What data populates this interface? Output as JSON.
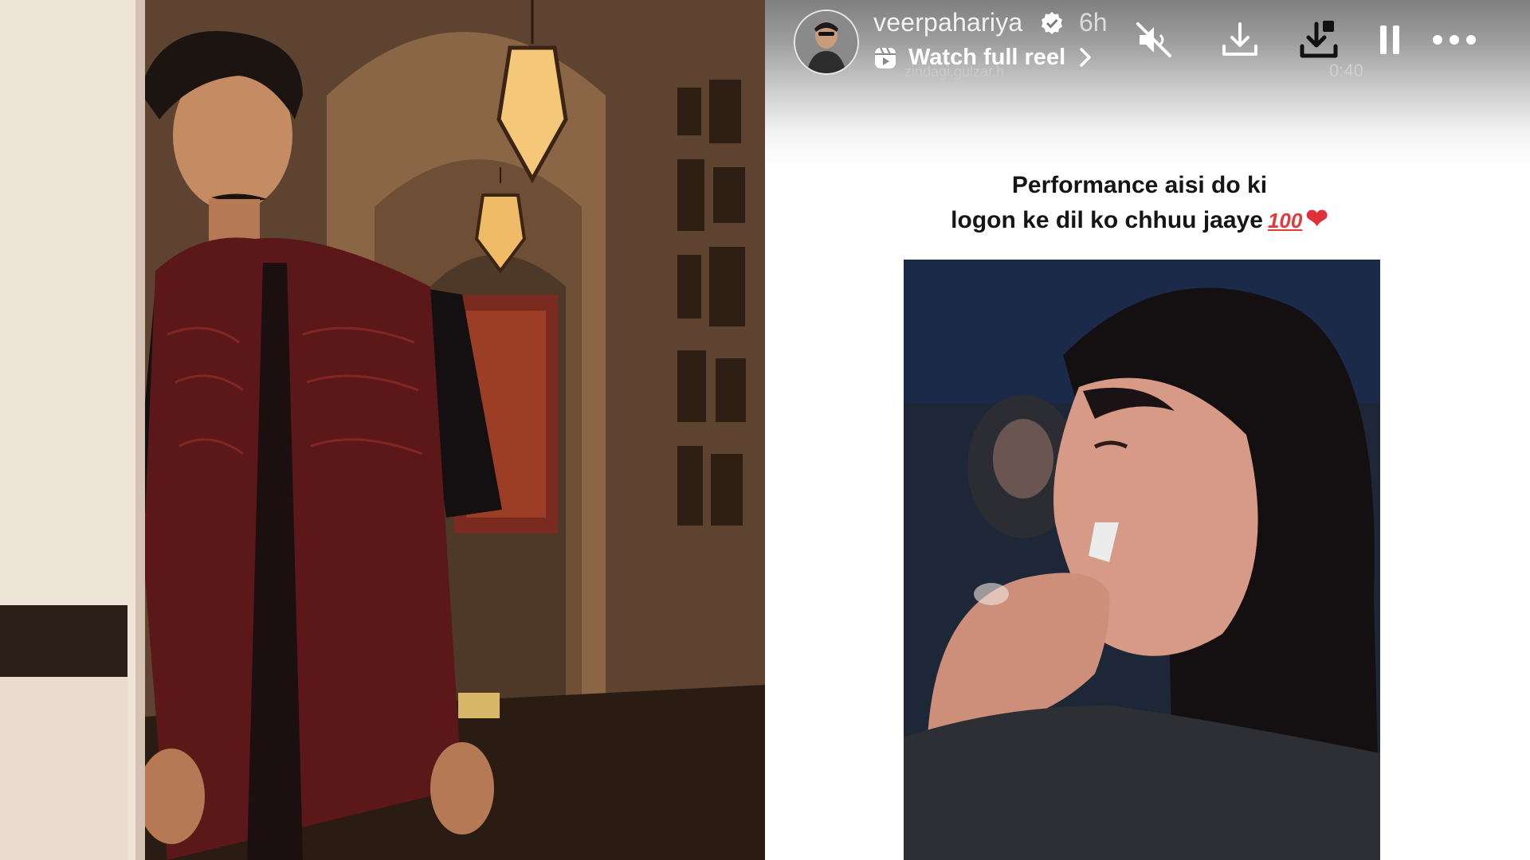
{
  "story": {
    "username": "veerpahariya",
    "timestamp": "6h",
    "reel_link_label": "Watch full reel",
    "faint_overlay_text": "zindagi.gulzar.h",
    "faint_time": "0:40",
    "caption": {
      "line1": "Performance aisi do ki",
      "line2": "logon ke dil ko chhuu jaaye",
      "emoji_100": "100",
      "emoji_heart": "❤"
    },
    "controls": {
      "mute_icon": "speaker-muted-icon",
      "download_icon": "download-icon",
      "save_icon": "save-download-icon",
      "pause_icon": "pause-icon",
      "more_icon": "more-options-icon"
    }
  },
  "colors": {
    "heart": "#e0303a",
    "text_dark": "#151515",
    "verified_badge": "#ffffff"
  }
}
